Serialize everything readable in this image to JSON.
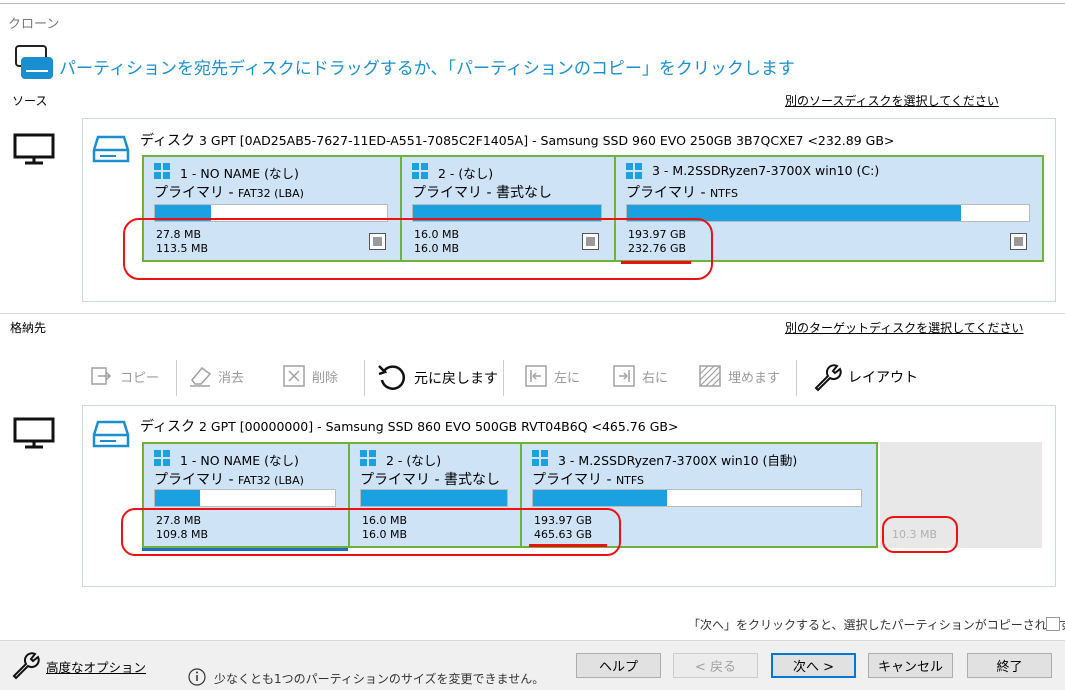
{
  "window": {
    "title": "クローン"
  },
  "headline": "パーティションを宛先ディスクにドラッグするか、「パーティションのコピー」をクリックします",
  "source": {
    "label": "ソース",
    "select_link": "別のソースディスクを選択してください",
    "disk": {
      "title_big": "ディスク",
      "title_rest": " 3 GPT [0AD25AB5-7627-11ED-A551-7085C2F1405A] - Samsung SSD 960 EVO 250GB 3B7QCXE7  <232.89 GB>",
      "partitions": [
        {
          "name": "1 - NO NAME (なし)",
          "type": "プライマリ - ",
          "fs": "FAT32 (LBA)",
          "used": "27.8 MB",
          "total": "113.5 MB",
          "fill": 0.24
        },
        {
          "name": "2 - (なし)",
          "type": "プライマリ - 書式なし",
          "fs": "",
          "used": "16.0 MB",
          "total": "16.0 MB",
          "fill": 1.0
        },
        {
          "name": "3 - M.2SSDRyzen7-3700X win10 (C:)",
          "type": "プライマリ - ",
          "fs": "NTFS",
          "used": "193.97 GB",
          "total": "232.76 GB",
          "fill": 0.83
        }
      ]
    }
  },
  "target": {
    "label": "格納先",
    "select_link": "別のターゲットディスクを選択してください",
    "toolbar": {
      "copy": "コピー",
      "erase": "消去",
      "delete": "削除",
      "undo": "元に戻します",
      "left": "左に",
      "right": "右に",
      "fill": "埋めます",
      "layout": "レイアウト"
    },
    "disk": {
      "title_big": "ディスク",
      "title_rest": " 2 GPT [00000000] - Samsung SSD 860 EVO 500GB RVT04B6Q  <465.76 GB>",
      "partitions": [
        {
          "name": "1 - NO NAME (なし)",
          "type": "プライマリ - ",
          "fs": "FAT32 (LBA)",
          "used": "27.8 MB",
          "total": "109.8 MB",
          "fill": 0.25
        },
        {
          "name": "2 - (なし)",
          "type": "プライマリ - 書式なし",
          "fs": "",
          "used": "16.0 MB",
          "total": "16.0 MB",
          "fill": 1.0
        },
        {
          "name": "3 - M.2SSDRyzen7-3700X win10 (自動)",
          "type": "プライマリ - ",
          "fs": "NTFS",
          "used": "193.97 GB",
          "total": "465.63 GB",
          "fill": 0.41
        }
      ],
      "unallocated": "10.3 MB"
    }
  },
  "copy_hint": "「次へ」をクリックすると、選択したパーティションがコピーされます",
  "footer": {
    "advanced": "高度なオプション",
    "warning": "少なくとも1つのパーティションのサイズを変更できません。",
    "help": "ヘルプ",
    "back": "< 戻る",
    "next": "次へ >",
    "cancel": "キャンセル",
    "finish": "終了"
  },
  "colors": {
    "accent": "#1a8fd0",
    "partition_border": "#6eb23c",
    "partition_bg": "#cfe3f7",
    "bar_fill": "#1ba1e2",
    "annotation": "#e11111"
  }
}
